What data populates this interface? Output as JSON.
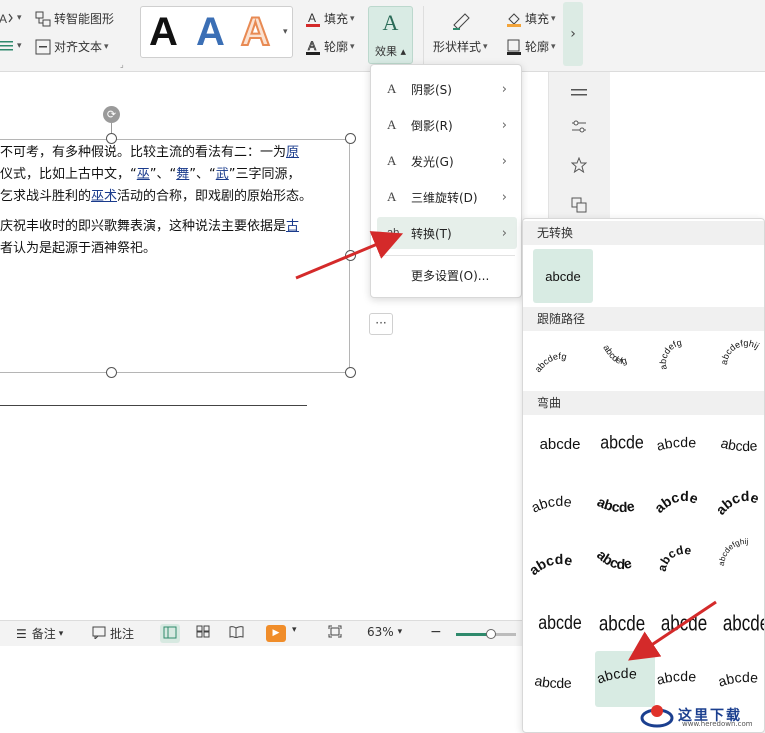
{
  "ribbon": {
    "smart_shape": "转智能图形",
    "align_text": "对齐文本",
    "fill_top": "填充",
    "outline_top": "轮廓",
    "effect": "效果",
    "shape_style": "形状样式",
    "fill_right": "填充",
    "outline_right": "轮廓",
    "wordart_sample": "A"
  },
  "document": {
    "lines": [
      {
        "text": "不可考，有多种假说。比较主流的看法有二：一为",
        "link": "原"
      },
      {
        "text": "仪式，比如上古中文，“",
        "link": "巫",
        "mid": "”、“",
        "link2": "舞",
        "mid2": "”、“",
        "link3": "武",
        "tail": "”三字同源，"
      },
      {
        "text": "乞求战斗胜利的",
        "link": "巫术",
        "tail": "活动的合称，即戏剧的原始形态。"
      },
      {
        "text": ""
      },
      {
        "text": "庆祝丰收时的即兴歌舞表演，这种说法主要依据是",
        "link": "古"
      },
      {
        "text": "者认为是起源于酒神祭祀。"
      }
    ],
    "more_button": "···"
  },
  "statusbar": {
    "notes": "备注",
    "comments": "批注",
    "zoom": "63%",
    "zoom_level_fraction": 0.58
  },
  "effect_menu": {
    "items": [
      {
        "label": "阴影(S)",
        "icon": "shadow-icon",
        "has_sub": true
      },
      {
        "label": "倒影(R)",
        "icon": "reflection-icon",
        "has_sub": true
      },
      {
        "label": "发光(G)",
        "icon": "glow-icon",
        "has_sub": true
      },
      {
        "label": "三维旋转(D)",
        "icon": "3d-rotate-icon",
        "has_sub": true
      },
      {
        "label": "转换(T)",
        "icon": "transform-icon",
        "has_sub": true,
        "highlighted": true
      }
    ],
    "more": "更多设置(O)..."
  },
  "transform_panel": {
    "no_transform_header": "无转换",
    "no_transform_sample": "abcde",
    "follow_path_header": "跟随路径",
    "follow_path_samples": [
      "abcdefg",
      "abcdefg",
      "abcdefg",
      "abcdefghij"
    ],
    "warp_header": "弯曲",
    "warp_sample": "abcde",
    "warp_sample_2": "abcde",
    "warp_sample_3": "abcdefghij"
  },
  "watermark": {
    "text": "这里下载",
    "url": "www.heredown.com"
  },
  "colors": {
    "accent": "#2f8a6c",
    "selection_bg": "#d8ebe3",
    "arrow_red": "#d42a2a",
    "link_blue": "#1a3b8c"
  }
}
